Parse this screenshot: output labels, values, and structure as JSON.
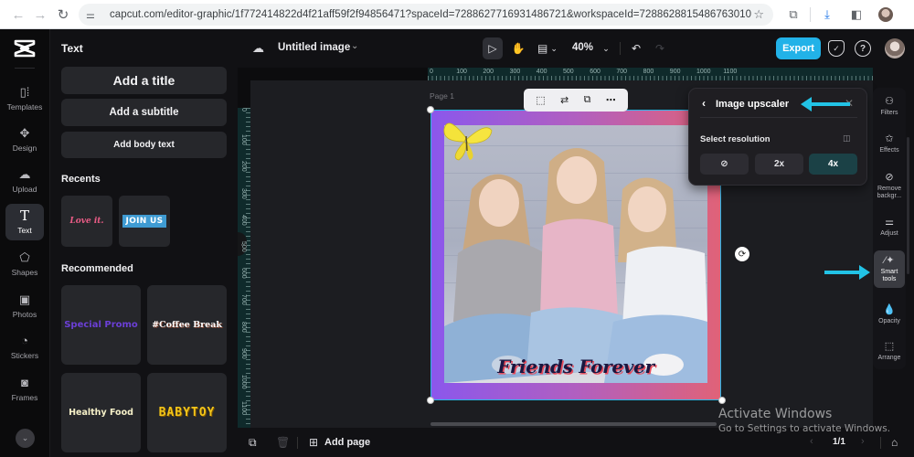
{
  "browser": {
    "url": "capcut.com/editor-graphic/1f772414822d4f21aff59f2f94856471?spaceId=7288627716931486721&workspaceId=7288628815486763010",
    "icons": [
      "back-icon",
      "forward-icon",
      "reload-icon",
      "site-settings-icon",
      "bookmark-star-icon",
      "extensions-icon",
      "download-icon",
      "side-panel-icon",
      "profile-avatar",
      "menu-kebab-icon"
    ]
  },
  "rail": {
    "items": [
      {
        "label": "Templates",
        "icon": "templates-icon"
      },
      {
        "label": "Design",
        "icon": "design-icon"
      },
      {
        "label": "Upload",
        "icon": "upload-cloud-icon"
      },
      {
        "label": "Text",
        "icon": "text-icon",
        "active": true
      },
      {
        "label": "Shapes",
        "icon": "shapes-icon"
      },
      {
        "label": "Photos",
        "icon": "photos-icon"
      },
      {
        "label": "Stickers",
        "icon": "stickers-icon"
      },
      {
        "label": "Frames",
        "icon": "frames-icon"
      }
    ]
  },
  "text_panel": {
    "title": "Text",
    "add_title": "Add a title",
    "add_subtitle": "Add a subtitle",
    "add_body": "Add body text",
    "recents_heading": "Recents",
    "recents": [
      "Love it.",
      "JOIN US"
    ],
    "recommended_heading": "Recommended",
    "recommended": [
      {
        "label": "Special Promo",
        "color": "#6b3fd6"
      },
      {
        "label": "#Coffee Break",
        "color": "#ffffff"
      },
      {
        "label": "Healthy Food",
        "color": "#f5f0c8"
      },
      {
        "label": "BABYTOY",
        "color": "#f2c51a"
      }
    ]
  },
  "header": {
    "doc_title": "Untitled image",
    "zoom": "40%",
    "export_label": "Export",
    "export_color": "#22b2e8"
  },
  "canvas": {
    "page_label": "Page 1",
    "ruler_top": [
      "0",
      "100",
      "200",
      "300",
      "400",
      "500",
      "600",
      "700",
      "800",
      "900",
      "1000",
      "1100"
    ],
    "ruler_left": [
      "0",
      "100",
      "200",
      "300",
      "400",
      "500",
      "600",
      "700",
      "800",
      "900",
      "1000",
      "1100"
    ],
    "artwork_text": "Friends Forever",
    "context_toolbar": [
      "crop-select-icon",
      "replace-icon",
      "duplicate-icon",
      "more-icon"
    ]
  },
  "upscaler": {
    "title": "Image upscaler",
    "label": "Select resolution",
    "options": [
      {
        "label": "none",
        "icon": "none-icon"
      },
      {
        "label": "2x"
      },
      {
        "label": "4x",
        "selected": true
      }
    ]
  },
  "tool_rail": {
    "items": [
      {
        "label": "Filters",
        "icon": "filters-icon"
      },
      {
        "label": "Effects",
        "icon": "effects-icon"
      },
      {
        "label": "Remove backgr...",
        "icon": "remove-background-icon"
      },
      {
        "label": "Adjust",
        "icon": "adjust-icon"
      },
      {
        "label": "Smart tools",
        "icon": "smart-tools-icon",
        "active": true
      },
      {
        "label": "Opacity",
        "icon": "opacity-icon"
      },
      {
        "label": "Arrange",
        "icon": "arrange-icon"
      }
    ]
  },
  "bottom_bar": {
    "add_page": "Add page",
    "pager": "1/1"
  },
  "watermark": {
    "line1": "Activate Windows",
    "line2": "Go to Settings to activate Windows."
  },
  "annotation_color": "#22c3e6"
}
